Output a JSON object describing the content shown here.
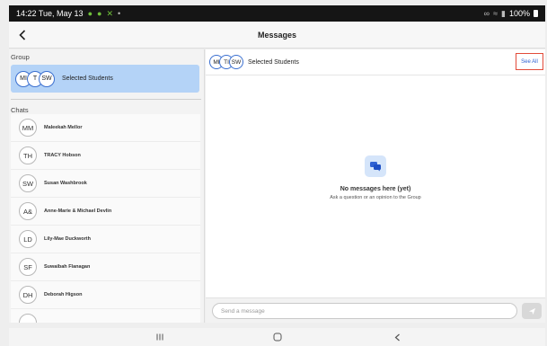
{
  "status_bar": {
    "time_date": "14:22  Tue, May 13",
    "battery": "100%"
  },
  "app": {
    "title": "Messages",
    "back_icon": "chevron-left-icon"
  },
  "left_panel": {
    "group_label": "Group",
    "group": {
      "avatars": [
        "MI",
        "T",
        "SW"
      ],
      "name": "Selected Students"
    },
    "chats_label": "Chats",
    "chats": [
      {
        "initials": "MM",
        "name": "Maleekah Mellor"
      },
      {
        "initials": "TH",
        "name": "TRACY Hobson"
      },
      {
        "initials": "SW",
        "name": "Susan Washbrook"
      },
      {
        "initials": "A&",
        "name": "Anne-Marie & Michael Devlin"
      },
      {
        "initials": "LD",
        "name": "Lily-Mae Duckworth"
      },
      {
        "initials": "SF",
        "name": "Suwaibah Flanagan"
      },
      {
        "initials": "DH",
        "name": "Deborah Higson"
      },
      {
        "initials": "",
        "name": ""
      }
    ]
  },
  "conversation": {
    "avatars": [
      "MI",
      "TI",
      "SW"
    ],
    "name": "Selected Students",
    "see_all": "See All",
    "empty_title": "No messages here (yet)",
    "empty_subtitle": "Ask a question or an opinion to the Group",
    "empty_icon": "chat-bubbles-icon",
    "composer_placeholder": "Send a message",
    "send_icon": "send-icon"
  },
  "colors": {
    "accent": "#2f62d3",
    "group_highlight": "#b4d3f7",
    "see_all_border": "#e24b3a"
  }
}
